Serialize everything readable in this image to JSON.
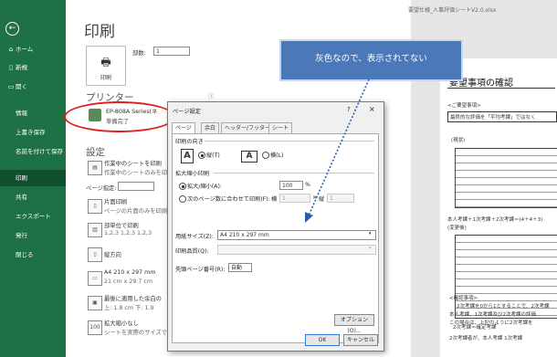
{
  "window": {
    "title": "要望仕様_人事評価シートV2.0.xlsx"
  },
  "nav": {
    "back_icon": "back-arrow-icon",
    "items": [
      {
        "label": "ホーム",
        "icon": "home-icon"
      },
      {
        "label": "新規",
        "icon": "new-icon"
      },
      {
        "label": "開く",
        "icon": "open-folder-icon"
      },
      {
        "label": "情報"
      },
      {
        "label": "上書き保存"
      },
      {
        "label": "名前を付けて保存"
      },
      {
        "label": "印刷"
      },
      {
        "label": "共有"
      },
      {
        "label": "エクスポート"
      },
      {
        "label": "発行"
      },
      {
        "label": "閉じる"
      }
    ],
    "selected": "印刷"
  },
  "print": {
    "title": "印刷",
    "print_button": "印刷",
    "copies_label": "部数:",
    "copies_value": "1",
    "printer_section": "プリンター",
    "printer_name": "EP-808A Series(ネ",
    "printer_status": "準備完了",
    "info_icon": "ⓘ",
    "settings_section": "設定",
    "settings": [
      {
        "line1": "作業中のシートを印刷",
        "line2": "作業中のシートのみを印"
      },
      {
        "line1": "ページ指定:"
      },
      {
        "line1": "片面印刷",
        "line2": "ページの片面のみを印刷"
      },
      {
        "line1": "部単位で印刷",
        "line2": "1,2,3    1,2,3    1,2,3"
      },
      {
        "line1": "縦方向"
      },
      {
        "line1": "A4 210 x 297 mm",
        "line2": "21 cm x 29.7 cm"
      },
      {
        "line1": "最後に適用した余白の",
        "line2": "上: 1.8 cm 下: 1.9"
      },
      {
        "line1": "拡大縮小なし",
        "line2": "シートを実際のサイズで"
      }
    ]
  },
  "callout": {
    "text": "灰色なので、表示されてない"
  },
  "dialog": {
    "title": "ページ設定",
    "help": "?",
    "close": "×",
    "tabs": [
      "ページ",
      "余白",
      "ヘッダー/フッター",
      "シート"
    ],
    "orientation_label": "印刷の向き",
    "portrait": "縦(T)",
    "landscape": "横(L)",
    "scaling_label": "拡大縮小印刷",
    "zoom_label": "拡大/縮小(A):",
    "zoom_value": "100",
    "zoom_unit": "%",
    "fit_label": "次のページ数に合わせて印刷(F):",
    "fit_wide_label": "横",
    "fit_wide_value": "1",
    "fit_x": "×",
    "fit_tall_label": "縦",
    "fit_tall_value": "1",
    "paper_size_label": "用紙サイズ(Z):",
    "paper_size_value": "A4 210 x 297 mm",
    "quality_label": "印刷品質(Q):",
    "quality_value": "",
    "first_page_label": "先頭ページ番号(R):",
    "first_page_value": "自動",
    "options_button": "オプション(O)...",
    "ok_button": "OK",
    "cancel_button": "キャンセル"
  },
  "preview": {
    "heading": "要望事項の確認",
    "lines": [
      "<ご要望事項>",
      "最終的な評価を「平均考課」ではなく",
      "(現状)",
      "本人考課＋1次考課＋2次考課＝(4＋4＋3)",
      "(変更後)",
      "2次考課＝確定考課",
      "<確認事項>",
      "2次考課を0から1とすることで、2次考課",
      "本人考課、1次考課及び2次考課の評価",
      "この場合は、上記のように2次考課を",
      "2次考課者が、本人考課 1次考課"
    ]
  }
}
